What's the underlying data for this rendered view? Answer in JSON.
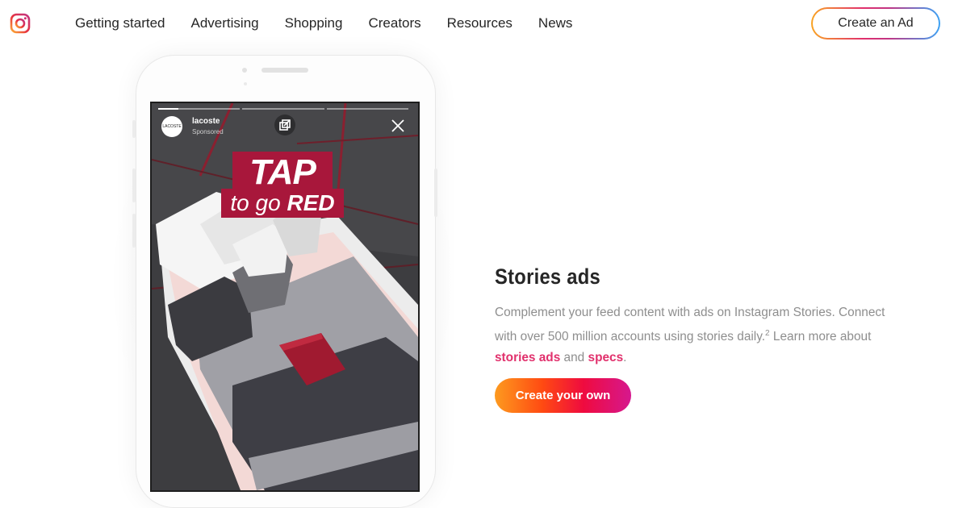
{
  "nav": {
    "logo_icon": "instagram-logo-icon",
    "links": [
      "Getting started",
      "Advertising",
      "Shopping",
      "Creators",
      "Resources",
      "News"
    ],
    "cta_label": "Create an Ad"
  },
  "story": {
    "username": "lacoste",
    "sponsored": "Sponsored",
    "avatar_text": "LACOSTE",
    "headline_top": "TAP",
    "headline_sub_prefix": "to go",
    "headline_sub_bold": "RED",
    "icons": [
      "share-icon",
      "close-icon"
    ]
  },
  "section": {
    "title": "Stories ads",
    "desc_part1": "Complement your feed content with ads on Instagram Stories. Connect with over 500 million accounts using stories daily.",
    "desc_sup": "2",
    "desc_part2": " Learn more about ",
    "link1": "stories ads",
    "desc_part3": " and ",
    "link2": "specs",
    "desc_part4": ".",
    "cta_label": "Create your own"
  },
  "colors": {
    "accent_link": "#e1306c",
    "tap_red": "#a8173b"
  }
}
